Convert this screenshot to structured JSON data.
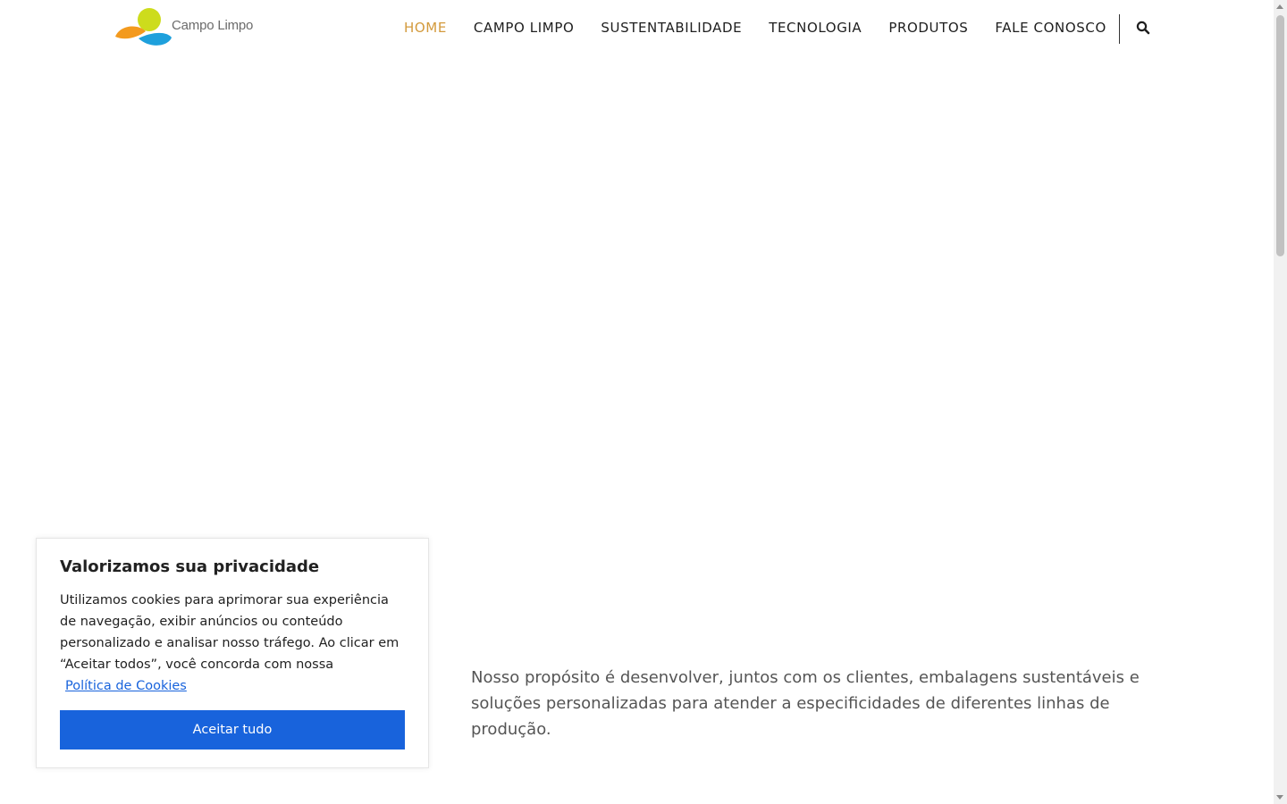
{
  "header": {
    "logo_text": "Campo Limpo",
    "nav": [
      {
        "label": "HOME",
        "active": true
      },
      {
        "label": "CAMPO LIMPO",
        "active": false
      },
      {
        "label": "SUSTENTABILIDADE",
        "active": false
      },
      {
        "label": "TECNOLOGIA",
        "active": false
      },
      {
        "label": "PRODUTOS",
        "active": false
      },
      {
        "label": "FALE CONOSCO",
        "active": false
      }
    ],
    "search_icon": "search-icon"
  },
  "main": {
    "purpose_text": "Nosso propósito é desenvolver, juntos com os clientes, embalagens sustentáveis e soluções personalizadas para atender a especificidades de diferentes linhas de produção."
  },
  "cookie_banner": {
    "title": "Valorizamos sua privacidade",
    "text": "Utilizamos cookies para aprimorar sua experiência de navegação, exibir anúncios ou conteúdo personalizado e analisar nosso tráfego. Ao clicar em “Aceitar todos”, você concorda com nossa",
    "policy_link": "Política de Cookies",
    "accept_label": "Aceitar tudo"
  },
  "colors": {
    "nav_active": "#d39a3c",
    "nav_text": "#1e1e1e",
    "accept_button": "#1863dc",
    "logo_orange": "#f39a1e",
    "logo_yellow_green": "#cddc1c",
    "logo_blue": "#1ea0dc"
  }
}
